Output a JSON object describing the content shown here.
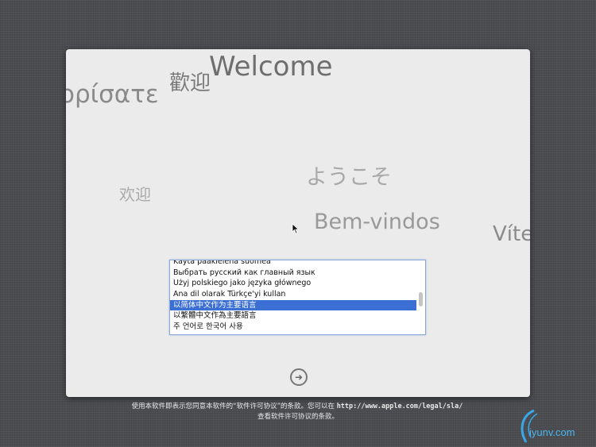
{
  "welcome_words": {
    "english": "Welcome",
    "greek": "ορίσατε",
    "trad_chinese": "歡迎",
    "japanese": "ようこそ",
    "simp_chinese": "欢迎",
    "portuguese": "Bem-vindos",
    "czech": "Víte"
  },
  "language_list": {
    "items": [
      "Käytä pääkielenä suomea",
      "Выбрать русский как главный язык",
      "Użyj polskiego jako języka głównego",
      "Ana dil olarak Türkçe'yi kullan",
      "以简体中文作为主要语言",
      "以繁體中文作為主要語言",
      "주 언어로 한국어 사용"
    ],
    "selected": "以简体中文作为主要语言"
  },
  "next_button": {
    "icon": "arrow-right-circle-icon",
    "glyph": "➜"
  },
  "footer": {
    "line1_prefix": "使用本软件即表示您同意本软件的“软件许可协议”的条款。您可以在 ",
    "url": "http://www.apple.com/legal/sla/",
    "line2": "查看软件许可协议的条款。"
  },
  "watermark": "iyunv.com",
  "colors": {
    "selection": "#3b6fd4",
    "panel": "#ebebeb",
    "background": "#4a4c50"
  }
}
